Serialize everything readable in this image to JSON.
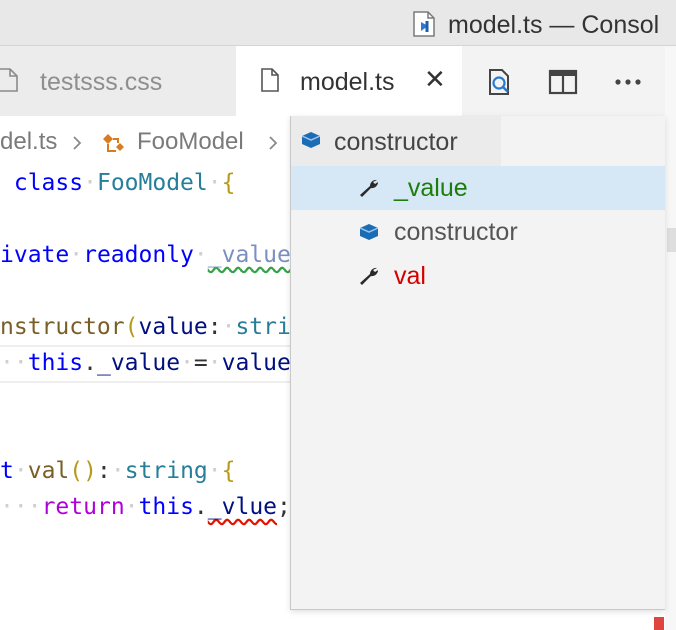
{
  "window": {
    "title": "model.ts — Consol"
  },
  "tabs": [
    {
      "label": "testsss.css",
      "active": false
    },
    {
      "label": "model.ts",
      "active": true,
      "close_glyph": "✕"
    }
  ],
  "toolbar_actions": [
    "open-changes-icon",
    "split-editor-icon",
    "more-actions-icon"
  ],
  "breadcrumbs": {
    "file": "del.ts",
    "class": "FooModel",
    "symbol": "constructor"
  },
  "code": {
    "line1": {
      "a": "class",
      "b": "FooModel",
      "c": "{"
    },
    "line2": {
      "a": "ivate",
      "b": "readonly",
      "c": "_value"
    },
    "line3": {
      "a": "nstructor",
      "b": "(",
      "c": "value",
      "d": ":",
      "e": "stri"
    },
    "line4": {
      "a": "this",
      "b": ".",
      "c": "_value",
      "d": "=",
      "e": "value"
    },
    "line5": {
      "a": "t",
      "b": "val",
      "c": "()",
      "d": ":",
      "e": "string",
      "f": "{"
    },
    "line6": {
      "a": "return",
      "b": "this",
      "c": ".",
      "d": "_vlue",
      "e": ";"
    }
  },
  "outline": {
    "header": {
      "label": "constructor",
      "icon": "method-icon"
    },
    "items": [
      {
        "label": "_value",
        "icon": "wrench-icon",
        "color": "#1d7d0b",
        "selected": true
      },
      {
        "label": "constructor",
        "icon": "method-icon",
        "color": "#555555",
        "selected": false
      },
      {
        "label": "val",
        "icon": "wrench-icon",
        "color": "#d40000",
        "selected": false
      }
    ]
  },
  "colors": {
    "accent_selection": "#d6e7f5",
    "error": "#e51400",
    "warning": "#35a24a",
    "method_icon": "#1c6cb5"
  }
}
